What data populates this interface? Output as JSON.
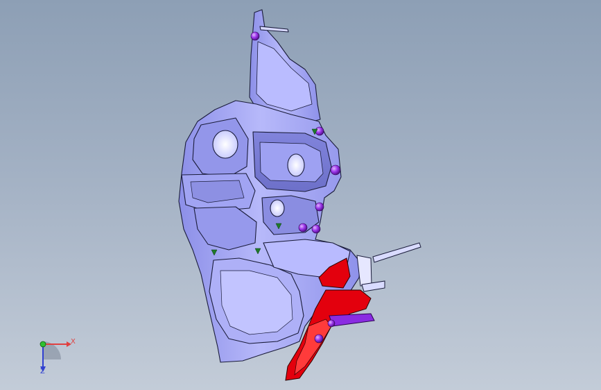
{
  "viewport": {
    "background_top": "#8d9fb5",
    "background_bottom": "#c3ccd8"
  },
  "model": {
    "body_color": "#a7a9f4",
    "edge_color": "#1a1c3a",
    "highlight_color": "#d4d6ff",
    "insert_color": "#e3000d",
    "pin_color": "#8a2be2",
    "marker_color": "#1f7a2a"
  },
  "triad": {
    "x_label": "X",
    "z_label": "Z",
    "x_color": "#e04040",
    "y_color": "#30c030",
    "z_color": "#3040d0"
  }
}
